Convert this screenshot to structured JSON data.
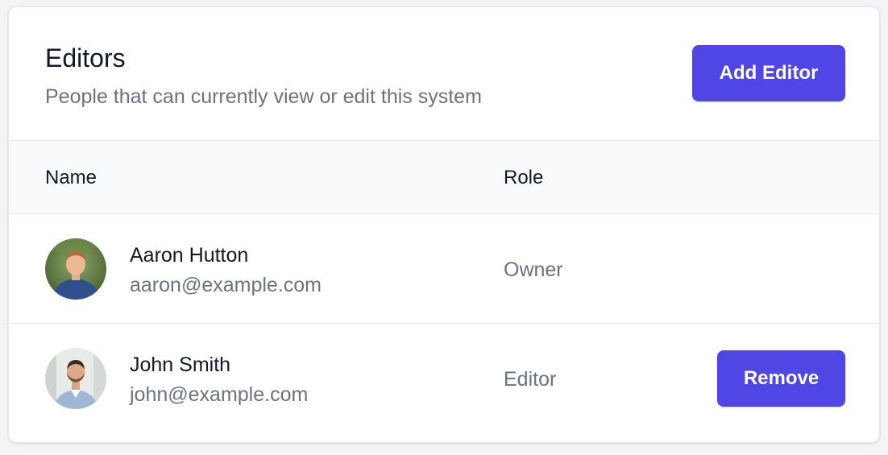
{
  "header": {
    "title": "Editors",
    "subtitle": "People that can currently view or edit this system",
    "add_button_label": "Add Editor"
  },
  "table": {
    "columns": [
      "Name",
      "Role"
    ],
    "rows": [
      {
        "name": "Aaron Hutton",
        "email": "aaron@example.com",
        "role": "Owner",
        "action_label": ""
      },
      {
        "name": "John Smith",
        "email": "john@example.com",
        "role": "Editor",
        "action_label": "Remove"
      }
    ]
  },
  "colors": {
    "accent": "#4f46e5",
    "text_primary": "#111827",
    "text_secondary": "#6b7280",
    "border": "#e5e7eb",
    "table_header_bg": "#f9fafb"
  }
}
